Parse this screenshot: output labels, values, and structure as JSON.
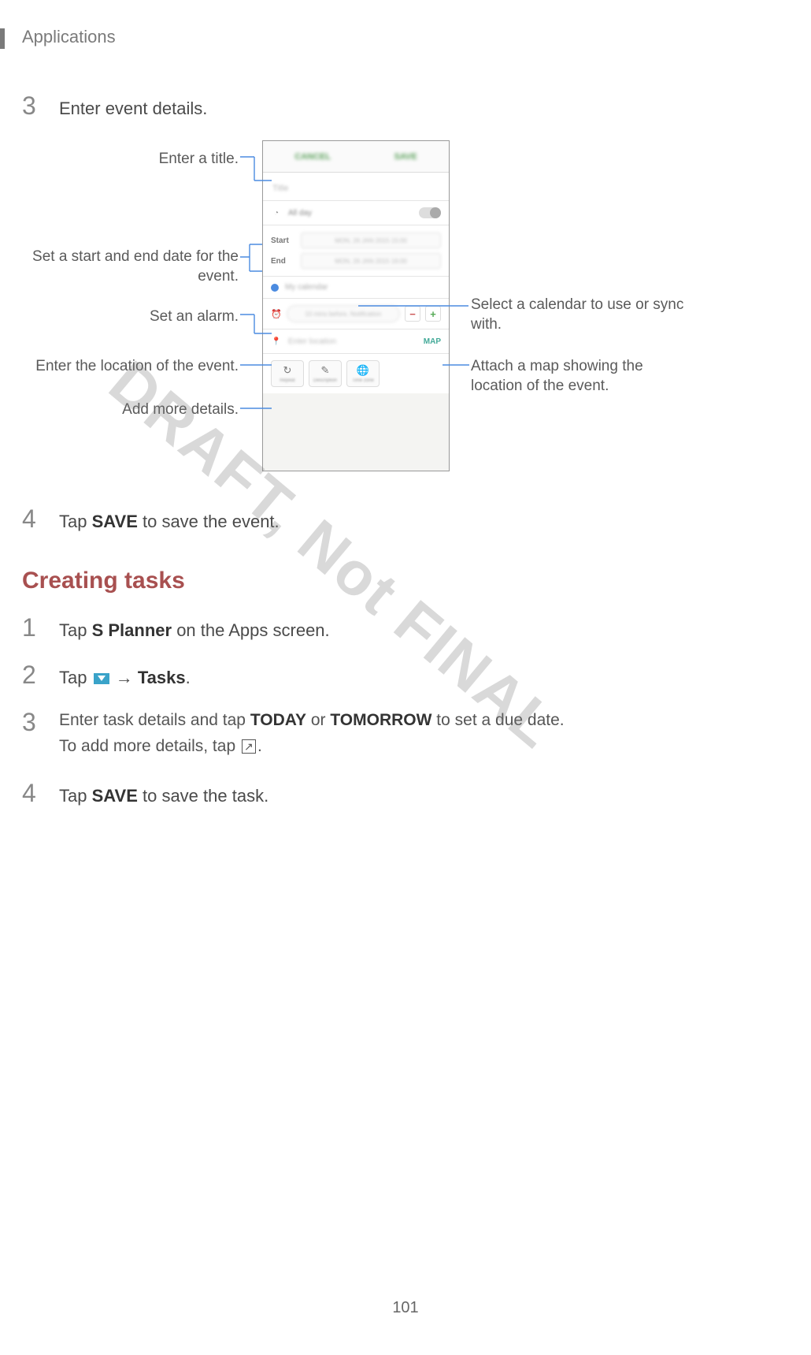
{
  "header": "Applications",
  "page_number": "101",
  "watermark": "DRAFT, Not FINAL",
  "step3": {
    "num": "3",
    "text": "Enter event details."
  },
  "callouts": {
    "title": "Enter a title.",
    "dates": "Set a start and end date for the event.",
    "alarm": "Set an alarm.",
    "location": "Enter the location of the event.",
    "more": "Add more details.",
    "calendar": "Select a calendar to use or sync with.",
    "map": "Attach a map showing the location of the event."
  },
  "phone": {
    "cancel": "CANCEL",
    "save": "SAVE",
    "title_placeholder": "Title",
    "allday": "All day",
    "start_label": "Start",
    "end_label": "End",
    "start_val": "MON, 26 JAN 2015   15:00",
    "end_val": "MON, 26 JAN 2015   16:00",
    "calendar_name": "My calendar",
    "alarm_chip": "10 mins before, Notification",
    "location_placeholder": "Enter location",
    "map": "MAP",
    "more": {
      "repeat": "Repeat",
      "description": "Description",
      "timezone": "Time zone"
    }
  },
  "step4a": {
    "num": "4",
    "pre": "Tap ",
    "bold": "SAVE",
    "post": " to save the event."
  },
  "section": "Creating tasks",
  "t1": {
    "num": "1",
    "pre": "Tap ",
    "bold": "S Planner",
    "post": " on the Apps screen."
  },
  "t2": {
    "num": "2",
    "pre": "Tap ",
    "arrow": " → ",
    "bold": "Tasks",
    "post": "."
  },
  "t3": {
    "num": "3",
    "line1_a": "Enter task details and tap ",
    "line1_b1": "TODAY",
    "line1_mid": " or ",
    "line1_b2": "TOMORROW",
    "line1_c": " to set a due date.",
    "line2_a": "To add more details, tap ",
    "line2_b": "."
  },
  "t4": {
    "num": "4",
    "pre": "Tap ",
    "bold": "SAVE",
    "post": " to save the task."
  }
}
